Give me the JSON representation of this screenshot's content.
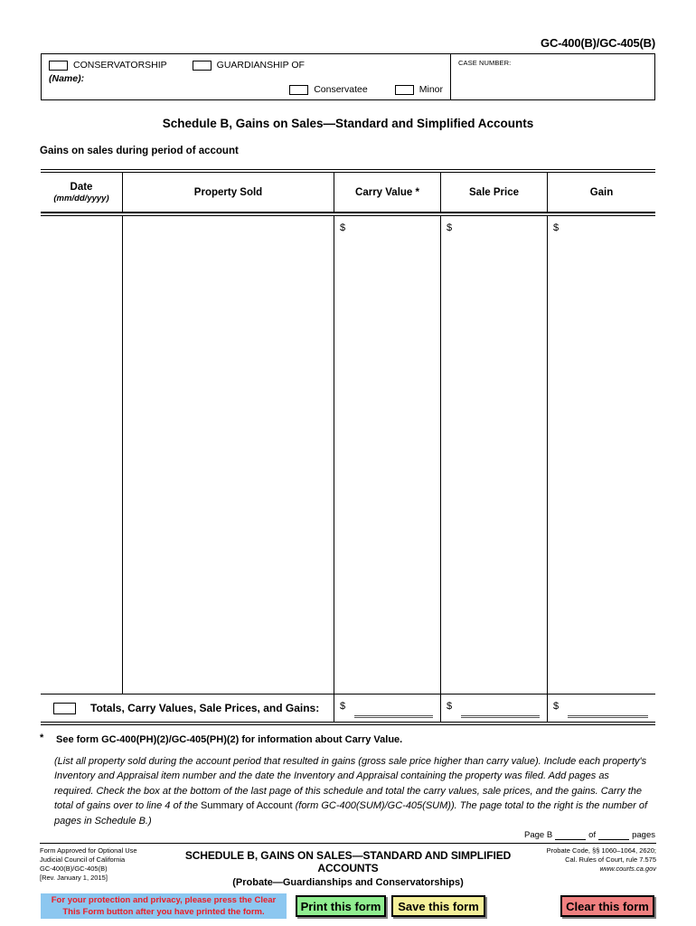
{
  "form_number": "GC-400(B)/GC-405(B)",
  "caption": {
    "conservatorship_label": "CONSERVATORSHIP",
    "guardianship_label": "GUARDIANSHIP OF",
    "name_label": "(Name):",
    "conservatee_label": "Conservatee",
    "minor_label": "Minor",
    "case_number_label": "CASE NUMBER:"
  },
  "title": "Schedule B, Gains on Sales—Standard and Simplified Accounts",
  "section_label": "Gains on sales during period of account",
  "table": {
    "headers": [
      {
        "label": "Date",
        "sub": "(mm/dd/yyyy)"
      },
      {
        "label": "Property Sold",
        "sub": ""
      },
      {
        "label": "Carry Value *",
        "sub": ""
      },
      {
        "label": "Sale Price",
        "sub": ""
      },
      {
        "label": "Gain",
        "sub": ""
      }
    ],
    "currency_symbol": "$",
    "totals_label": "Totals, Carry Values, Sale Prices, and Gains:"
  },
  "footnote": {
    "star": "*",
    "text": "See form GC-400(PH)(2)/GC-405(PH)(2) for information about Carry Value."
  },
  "instructions": {
    "part1": "(List all property sold during the account period that resulted in gains (gross sale price higher than carry value). Include each property's Inventory and Appraisal item number and the date the Inventory and Appraisal containing the property was filed. Add pages as required. Check the box at the bottom of the last page of this schedule and total the carry values, sale prices, and the gains. Carry the total of gains over to line 4 of the ",
    "roman": "Summary of Account ",
    "part2": "(form GC-400(SUM)/GC-405(SUM)). The page total to the right is the number of pages in Schedule B.)"
  },
  "page_line": {
    "prefix": "Page B",
    "middle": "of",
    "suffix": "pages"
  },
  "footer": {
    "left_lines": [
      "Form Approved for Optional Use",
      "Judicial Council of California",
      "GC-400(B)/GC-405(B)",
      "[Rev. January 1, 2015]"
    ],
    "center_line1": "SCHEDULE B, GAINS ON SALES—STANDARD AND SIMPLIFIED ACCOUNTS",
    "center_line2": "(Probate—Guardianships and Conservatorships)",
    "right_lines": [
      "Probate Code, §§ 1060–1064, 2620;",
      "Cal. Rules  of Court, rule 7.575"
    ],
    "right_url": "www.courts.ca.gov"
  },
  "buttons": {
    "privacy_note_line1": "For your protection and privacy, please press the Clear",
    "privacy_note_line2": "This Form button after you have printed the form.",
    "print_label": "Print this form",
    "save_label": "Save this form",
    "clear_label": "Clear this form"
  },
  "colors": {
    "print_bg": "#90EE90",
    "save_bg": "#F5F09A",
    "clear_bg": "#F08080",
    "privacy_bg": "#8CC7F0",
    "privacy_text": "#ED1C24"
  }
}
